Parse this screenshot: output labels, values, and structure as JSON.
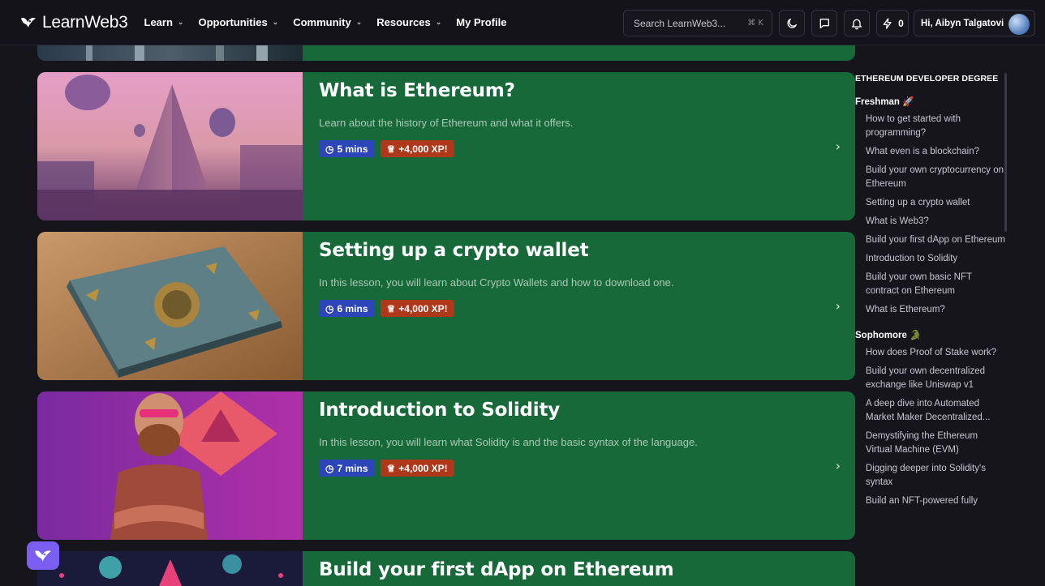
{
  "brand": {
    "name": "LearnWeb3"
  },
  "nav": {
    "items": [
      {
        "label": "Learn",
        "dropdown": true
      },
      {
        "label": "Opportunities",
        "dropdown": true
      },
      {
        "label": "Community",
        "dropdown": true
      },
      {
        "label": "Resources",
        "dropdown": true
      },
      {
        "label": "My Profile",
        "dropdown": false
      }
    ],
    "search_placeholder": "Search LearnWeb3...",
    "search_shortcut": "⌘ K",
    "xp_count": "0",
    "greeting": "Hi, Aibyn Talgatovi"
  },
  "lessons": [
    {
      "title": "What is Ethereum?",
      "description": "Learn about the history of Ethereum and what it offers.",
      "duration": "5 mins",
      "xp": "+4,000 XP!"
    },
    {
      "title": "Setting up a crypto wallet",
      "description": "In this lesson, you will learn about Crypto Wallets and how to download one.",
      "duration": "6 mins",
      "xp": "+4,000 XP!"
    },
    {
      "title": "Introduction to Solidity",
      "description": "In this lesson, you will learn what Solidity is and the basic syntax of the language.",
      "duration": "7 mins",
      "xp": "+4,000 XP!"
    },
    {
      "title": "Build your first dApp on Ethereum"
    }
  ],
  "sidebar": {
    "heading": "ETHEREUM DEVELOPER DEGREE",
    "sections": [
      {
        "name": "Freshman",
        "emoji": "🚀",
        "items": [
          "How to get started with programming?",
          "What even is a blockchain?",
          "Build your own cryptocurrency on Ethereum",
          "Setting up a crypto wallet",
          "What is Web3?",
          "Build your first dApp on Ethereum",
          "Introduction to Solidity",
          "Build your own basic NFT contract on Ethereum",
          "What is Ethereum?"
        ]
      },
      {
        "name": "Sophomore",
        "emoji": "🐊",
        "items": [
          "How does Proof of Stake work?",
          "Build your own decentralized exchange like Uniswap v1",
          "A deep dive into Automated Market Maker Decentralized...",
          "Demystifying the Ethereum Virtual Machine (EVM)",
          "Digging deeper into Solidity's syntax",
          "Build an NFT-powered fully"
        ]
      }
    ]
  },
  "colors": {
    "card_bg": "#17693a",
    "time_badge": "#2c45b8",
    "xp_badge": "#b0381a",
    "page_bg": "#16151c",
    "fab": "#7b5ef2"
  },
  "icons": [
    "logo-bird-icon",
    "moon-icon",
    "chat-icon",
    "bell-icon",
    "bolt-icon",
    "clock-icon",
    "trophy-icon",
    "chevron-right-icon",
    "help-bird-icon"
  ]
}
